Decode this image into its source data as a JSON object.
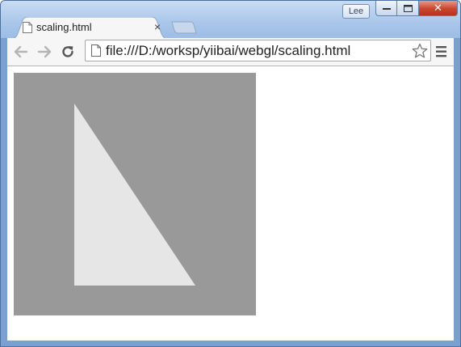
{
  "window": {
    "profile_name": "Lee",
    "controls": {
      "minimize": "–",
      "maximize": "□",
      "close": "✕"
    }
  },
  "tab": {
    "title": "scaling.html",
    "close_label": "×",
    "icon": "page-icon"
  },
  "toolbar": {
    "back_icon": "back-arrow-icon",
    "forward_icon": "forward-arrow-icon",
    "reload_icon": "reload-icon",
    "url": "file:///D:/worksp/yiibai/webgl/scaling.html",
    "bookmark_icon": "star-icon",
    "menu_icon": "hamburger-menu-icon"
  },
  "canvas": {
    "background_color": "#999999",
    "shape_color": "#e6e6e6",
    "shape": "triangle"
  }
}
